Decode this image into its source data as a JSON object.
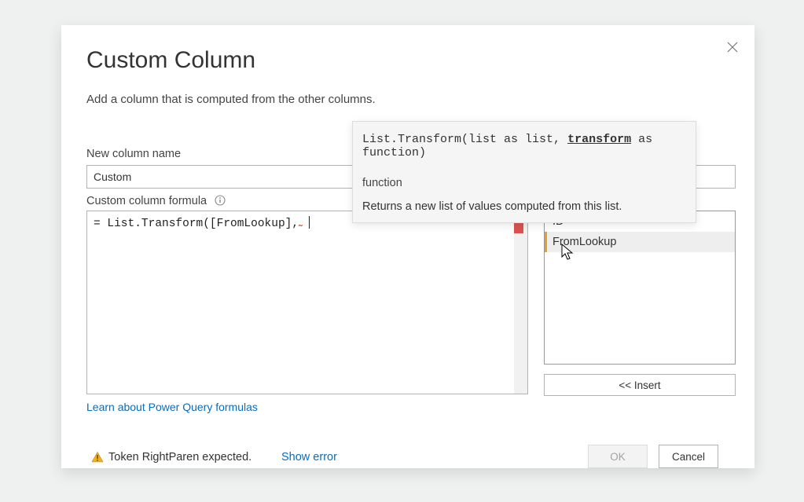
{
  "dialog": {
    "title": "Custom Column",
    "subtitle": "Add a column that is computed from the other columns."
  },
  "newColumnName": {
    "label": "New column name",
    "value": "Custom"
  },
  "formula": {
    "label": "Custom column formula",
    "prefix": "= ",
    "code": "List.Transform([FromLookup],"
  },
  "availableColumns": [
    {
      "name": "ID",
      "selected": false
    },
    {
      "name": "FromLookup",
      "selected": true
    }
  ],
  "insertButton": {
    "label": "<< Insert"
  },
  "learnLink": {
    "label": "Learn about Power Query formulas"
  },
  "validation": {
    "message": "Token RightParen expected.",
    "showErrorLabel": "Show error"
  },
  "buttons": {
    "ok": "OK",
    "cancel": "Cancel"
  },
  "tooltip": {
    "sig_fn": "List.Transform",
    "sig_part1": "(list as list, ",
    "sig_emph": "transform",
    "sig_part2": " as function)",
    "type": "function",
    "desc": "Returns a new list of values computed from this list."
  }
}
